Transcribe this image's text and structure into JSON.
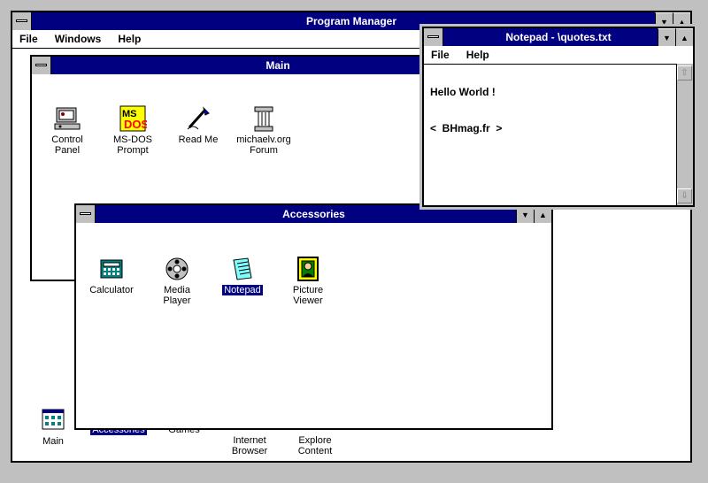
{
  "program_manager": {
    "title": "Program Manager",
    "menu": [
      "File",
      "Windows",
      "Help"
    ],
    "group_icons": [
      {
        "label": "Main",
        "icon": "program-group-icon",
        "selected": false
      },
      {
        "label": "Accessories",
        "icon": "program-group-icon",
        "selected": true
      },
      {
        "label": "Games",
        "icon": "program-group-icon",
        "selected": false
      },
      {
        "label": "Internet\nBrowser",
        "icon": "program-group-icon",
        "selected": false
      },
      {
        "label": "Explore\nContent",
        "icon": "program-group-icon",
        "selected": false
      }
    ]
  },
  "main_group": {
    "title": "Main",
    "icons": [
      {
        "label": "Control\nPanel",
        "icon": "control-panel-icon"
      },
      {
        "label": "MS-DOS\nPrompt",
        "icon": "ms-dos-icon"
      },
      {
        "label": "Read Me",
        "icon": "read-me-icon"
      },
      {
        "label": "michaelv.org\nForum",
        "icon": "forum-column-icon"
      }
    ]
  },
  "accessories_group": {
    "title": "Accessories",
    "icons": [
      {
        "label": "Calculator",
        "icon": "calculator-icon",
        "selected": false
      },
      {
        "label": "Media\nPlayer",
        "icon": "media-player-icon",
        "selected": false
      },
      {
        "label": "Notepad",
        "icon": "notepad-icon",
        "selected": true
      },
      {
        "label": "Picture\nViewer",
        "icon": "picture-viewer-icon",
        "selected": false
      }
    ]
  },
  "notepad": {
    "title": "Notepad - \\quotes.txt",
    "menu": [
      "File",
      "Help"
    ],
    "lines": [
      "Hello World !",
      "<  BHmag.fr  >"
    ]
  },
  "controls": {
    "minimize": "▼",
    "maximize": "▲",
    "scroll_up": "⇧",
    "scroll_down": "⇩"
  },
  "colors": {
    "titlebar": "#000080",
    "desktop": "#c0c0c0",
    "selection": "#000080"
  }
}
